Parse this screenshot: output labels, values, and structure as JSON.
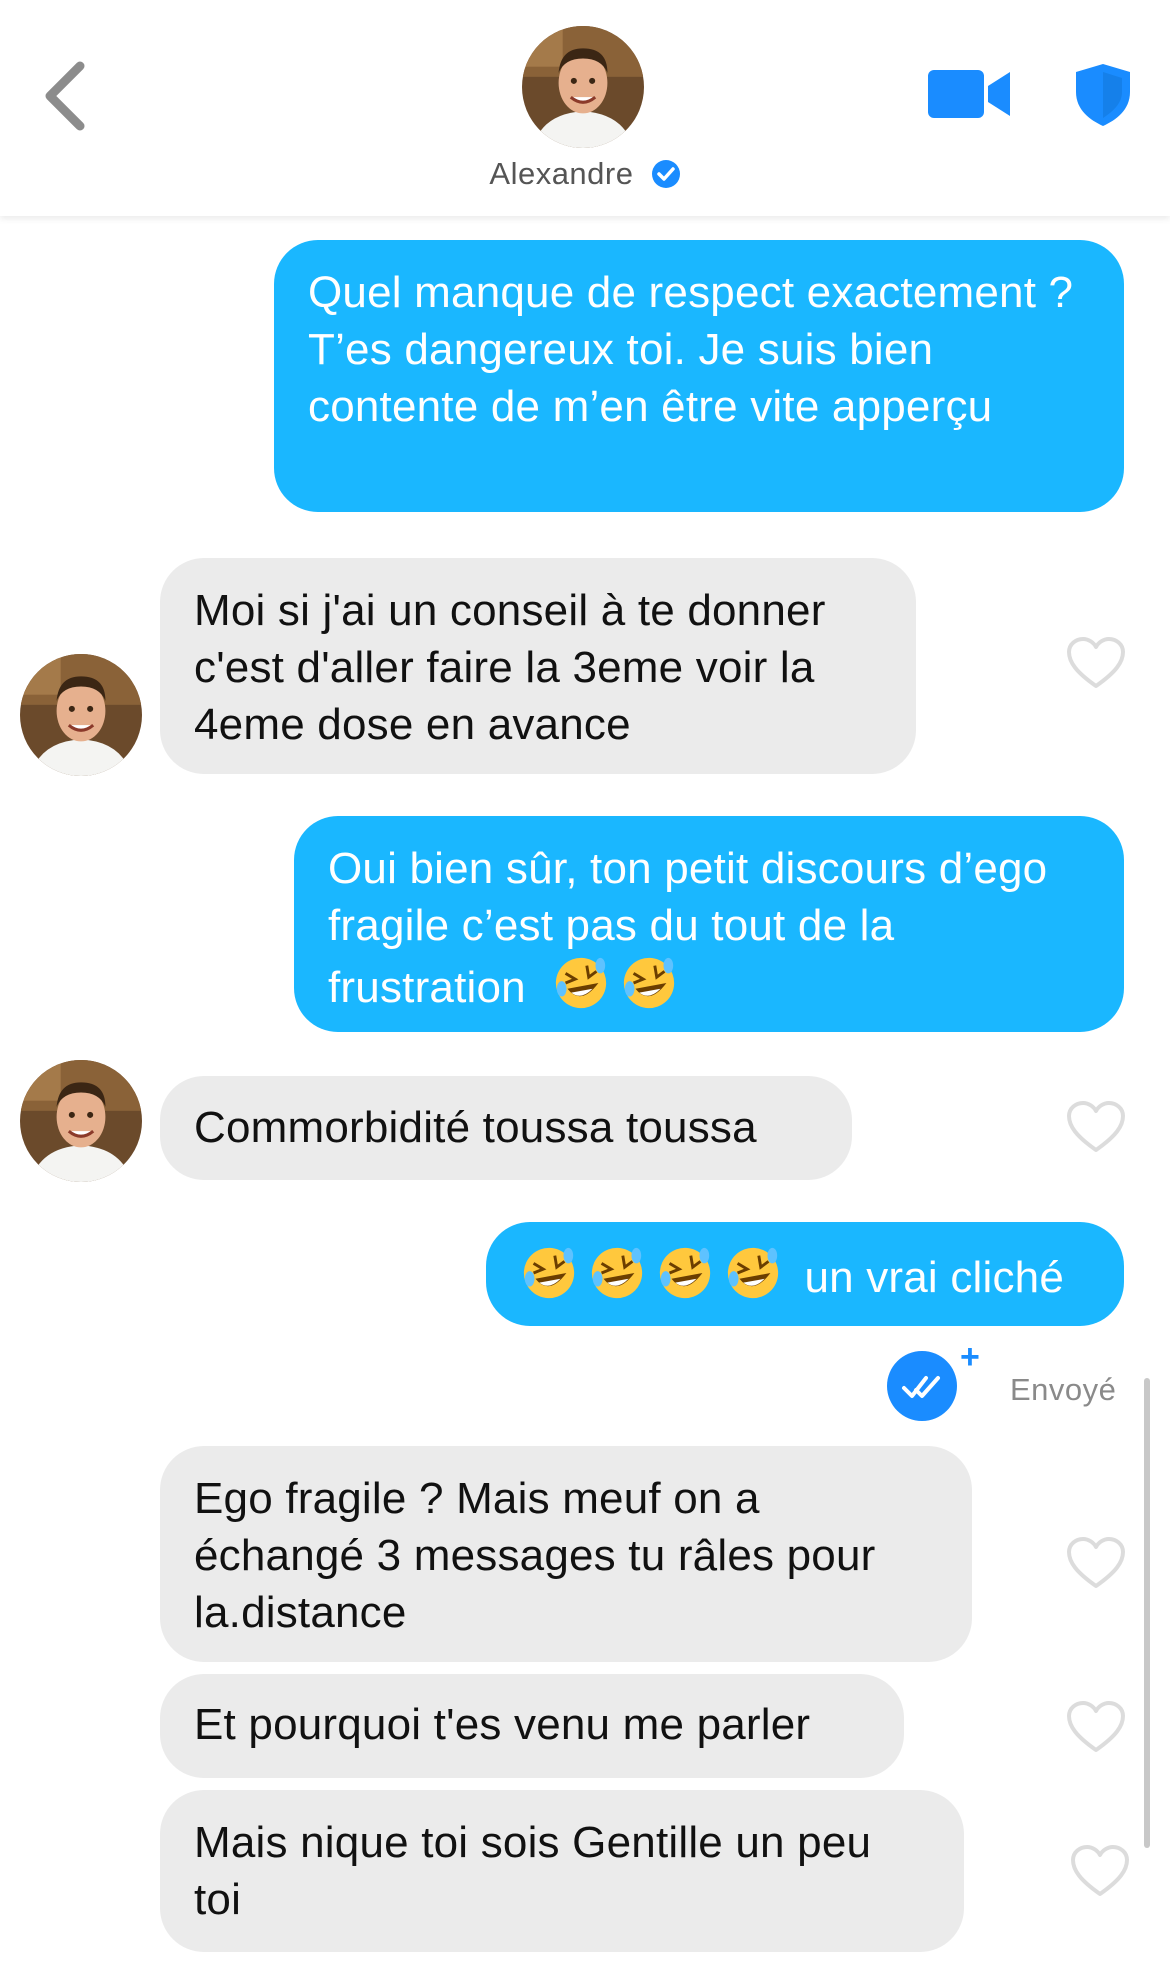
{
  "header": {
    "contact_name": "Alexandre",
    "back_icon": "chevron-left-icon",
    "video_icon": "video-camera-icon",
    "safety_icon": "shield-icon",
    "verified_icon": "verified-badge-icon",
    "accent": "#1a8cff"
  },
  "colors": {
    "outgoing_bubble": "#1ab7ff",
    "incoming_bubble": "#ebebeb",
    "heart_outline": "#dcdcdc"
  },
  "messages": [
    {
      "dir": "out",
      "text": "Quel manque de respect exactement ? T’es dangereux toi. Je suis bien contente de m’en être vite apperçu"
    },
    {
      "dir": "in",
      "text": "Moi si j'ai un conseil à te donner c'est d'aller faire la 3eme voir la 4eme dose en avance"
    },
    {
      "dir": "out",
      "text": "Oui bien sûr, ton petit discours d’ego fragile c’est pas du tout de la frustration",
      "emoji_count": 2
    },
    {
      "dir": "in",
      "text": "Commorbidité toussa toussa"
    },
    {
      "dir": "out",
      "text": "un vrai cliché",
      "emoji_count": 4
    },
    {
      "dir": "in",
      "text": "Ego fragile ? Mais meuf on a échangé 3 messages tu râles pour la.distance"
    },
    {
      "dir": "in",
      "text": "Et pourquoi t'es venu me parler"
    },
    {
      "dir": "in",
      "text": "Mais nique toi sois Gentille un peu toi"
    }
  ],
  "status": {
    "sent_label": "Envoyé",
    "plus": "+"
  }
}
